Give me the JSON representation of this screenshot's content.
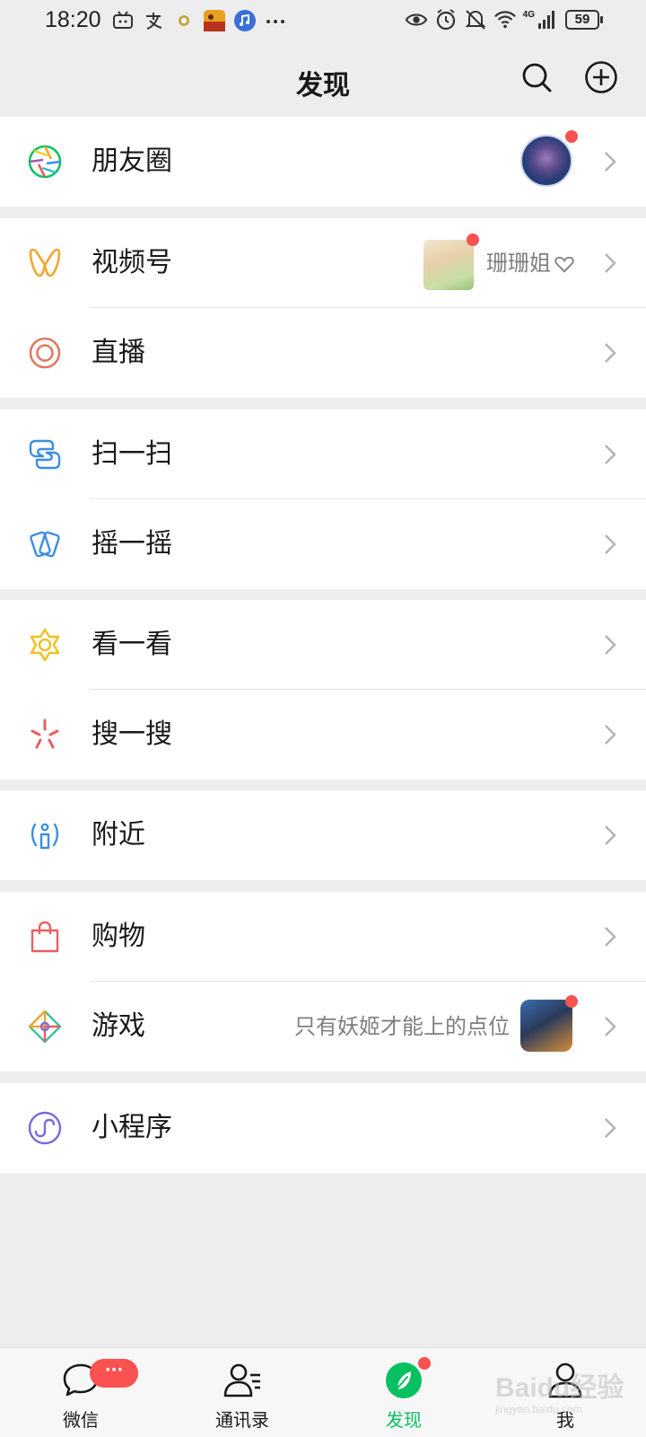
{
  "status_bar": {
    "time": "18:20",
    "left_icons": [
      "bilibili-icon",
      "alipay-icon",
      "small-app-icon",
      "game-app-icon",
      "music-icon",
      "more-dots-icon"
    ],
    "right_icons": [
      "eye-icon",
      "alarm-icon",
      "mute-icon",
      "wifi-icon",
      "signal-4g-icon"
    ],
    "network_label": "4G",
    "battery": "59"
  },
  "header": {
    "title": "发现",
    "actions": [
      "search-icon",
      "add-circle-icon"
    ]
  },
  "groups": [
    {
      "items": [
        {
          "id": "moments",
          "label": "朋友圈",
          "icon": "moments-aperture-icon",
          "has_dot": true
        }
      ]
    },
    {
      "items": [
        {
          "id": "channels",
          "label": "视频号",
          "icon": "channels-icon",
          "extra": "珊珊姐",
          "has_dot": true
        },
        {
          "id": "live",
          "label": "直播",
          "icon": "live-icon"
        }
      ]
    },
    {
      "items": [
        {
          "id": "scan",
          "label": "扫一扫",
          "icon": "scan-icon"
        },
        {
          "id": "shake",
          "label": "摇一摇",
          "icon": "shake-icon"
        }
      ]
    },
    {
      "items": [
        {
          "id": "top-stories",
          "label": "看一看",
          "icon": "top-stories-icon"
        },
        {
          "id": "search",
          "label": "搜一搜",
          "icon": "search-spark-icon"
        }
      ]
    },
    {
      "items": [
        {
          "id": "nearby",
          "label": "附近",
          "icon": "nearby-icon"
        }
      ]
    },
    {
      "items": [
        {
          "id": "shopping",
          "label": "购物",
          "icon": "shopping-bag-icon"
        },
        {
          "id": "games",
          "label": "游戏",
          "icon": "games-icon",
          "extra": "只有妖姬才能上的点位",
          "has_dot": true
        }
      ]
    },
    {
      "items": [
        {
          "id": "mini-programs",
          "label": "小程序",
          "icon": "mini-programs-icon"
        }
      ]
    }
  ],
  "tabbar": {
    "tabs": [
      {
        "label": "微信",
        "icon": "chat-bubble-icon",
        "badge": "···"
      },
      {
        "label": "通讯录",
        "icon": "contacts-icon"
      },
      {
        "label": "发现",
        "icon": "discover-compass-icon",
        "active": true,
        "has_dot": true
      },
      {
        "label": "我",
        "icon": "me-person-icon"
      }
    ]
  },
  "watermark": {
    "text": "Baidu经验",
    "sub": "jingyan.baidu.com"
  },
  "colors": {
    "background": "#ededed",
    "row_background": "#ffffff",
    "active_green": "#07c160",
    "red_dot": "#fa5151",
    "secondary_text": "#7f7f7f"
  }
}
